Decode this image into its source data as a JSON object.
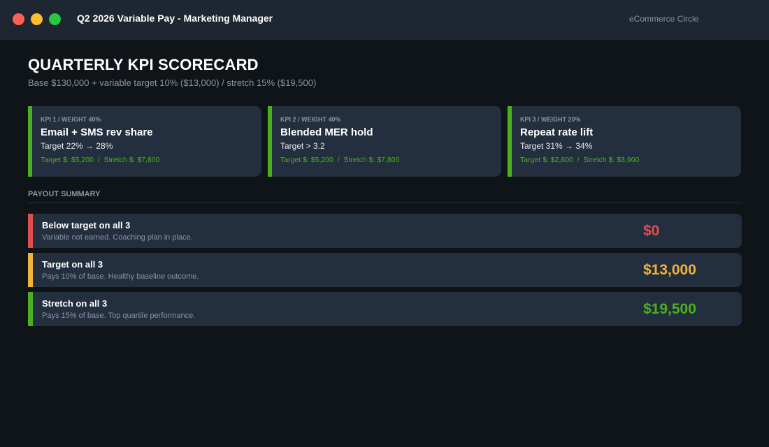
{
  "window": {
    "title": "Q2 2026 Variable Pay - Marketing Manager",
    "brand": "eCommerce Circle"
  },
  "header": {
    "title": "QUARTERLY KPI SCORECARD",
    "subtitle": "Base $130,000 + variable target 10% ($13,000) / stretch 15% ($19,500)"
  },
  "kpis": [
    {
      "weight": "KPI 1 / WEIGHT 40%",
      "name": "Email + SMS rev share",
      "target": "Target 22% → 28%",
      "payouts": "Target $: $5,200  /  Stretch $: $7,800"
    },
    {
      "weight": "KPI 2 / WEIGHT 40%",
      "name": "Blended MER hold",
      "target": "Target > 3.2",
      "payouts": "Target $: $5,200  /  Stretch $: $7,800"
    },
    {
      "weight": "KPI 3 / WEIGHT 20%",
      "name": "Repeat rate lift",
      "target": "Target 31% → 34%",
      "payouts": "Target $: $2,600  /  Stretch $: $3,900"
    }
  ],
  "summary": {
    "label": "PAYOUT SUMMARY",
    "rows": [
      {
        "title": "Below target on all 3",
        "description": "Variable not earned. Coaching plan in place.",
        "amount": "$0",
        "color": "#e04f4f"
      },
      {
        "title": "Target on all 3",
        "description": "Pays 10% of base. Healthy baseline outcome.",
        "amount": "$13,000",
        "color": "#f0b23a"
      },
      {
        "title": "Stretch on all 3",
        "description": "Pays 15% of base. Top quartile performance.",
        "amount": "$19,500",
        "color": "#4caf1f"
      }
    ]
  },
  "colors": {
    "kpi_accent": "#4caf1f",
    "background": "#0f1419",
    "card": "#232f3e"
  }
}
